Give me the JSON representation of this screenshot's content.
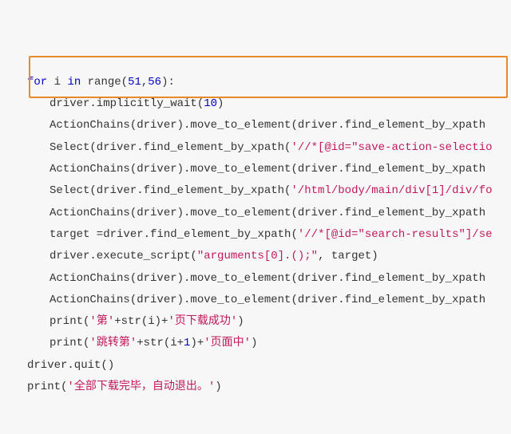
{
  "code": {
    "lines": [
      {
        "indent": 1,
        "segments": [
          {
            "t": "kw",
            "v": "for"
          },
          {
            "t": "p",
            "v": " i "
          },
          {
            "t": "kw",
            "v": "in"
          },
          {
            "t": "p",
            "v": " range("
          },
          {
            "t": "num",
            "v": "51"
          },
          {
            "t": "p",
            "v": ","
          },
          {
            "t": "num",
            "v": "56"
          },
          {
            "t": "p",
            "v": "):"
          }
        ]
      },
      {
        "indent": 2,
        "segments": [
          {
            "t": "p",
            "v": "driver.implicitly_wait("
          },
          {
            "t": "num",
            "v": "10"
          },
          {
            "t": "p",
            "v": ")"
          }
        ]
      },
      {
        "indent": 2,
        "segments": [
          {
            "t": "p",
            "v": "ActionChains(driver).move_to_element(driver.find_element_by_xpath"
          }
        ]
      },
      {
        "indent": 2,
        "segments": [
          {
            "t": "p",
            "v": ""
          }
        ]
      },
      {
        "indent": 2,
        "segments": [
          {
            "t": "p",
            "v": "Select(driver.find_element_by_xpath("
          },
          {
            "t": "str",
            "v": "'//*[@id=\"save-action-selectio"
          }
        ]
      },
      {
        "indent": 2,
        "segments": [
          {
            "t": "p",
            "v": "ActionChains(driver).move_to_element(driver.find_element_by_xpath"
          }
        ]
      },
      {
        "indent": 2,
        "segments": [
          {
            "t": "p",
            "v": "Select(driver.find_element_by_xpath("
          },
          {
            "t": "str",
            "v": "'/html/body/main/div[1]/div/fo"
          }
        ]
      },
      {
        "indent": 2,
        "segments": [
          {
            "t": "p",
            "v": "ActionChains(driver).move_to_element(driver.find_element_by_xpath"
          }
        ]
      },
      {
        "indent": 2,
        "segments": [
          {
            "t": "p",
            "v": ""
          }
        ]
      },
      {
        "indent": 2,
        "segments": [
          {
            "t": "p",
            "v": "target =driver.find_element_by_xpath("
          },
          {
            "t": "str",
            "v": "'//*[@id=\"search-results\"]/se"
          }
        ]
      },
      {
        "indent": 2,
        "segments": [
          {
            "t": "p",
            "v": ""
          }
        ]
      },
      {
        "indent": 2,
        "segments": [
          {
            "t": "p",
            "v": "driver.execute_script("
          },
          {
            "t": "str",
            "v": "\"arguments[0].();\""
          },
          {
            "t": "p",
            "v": ", target)"
          }
        ]
      },
      {
        "indent": 2,
        "segments": [
          {
            "t": "p",
            "v": "ActionChains(driver).move_to_element(driver.find_element_by_xpath"
          }
        ]
      },
      {
        "indent": 2,
        "segments": [
          {
            "t": "p",
            "v": "ActionChains(driver).move_to_element(driver.find_element_by_xpath"
          }
        ]
      },
      {
        "indent": 2,
        "segments": [
          {
            "t": "p",
            "v": "print("
          },
          {
            "t": "str",
            "v": "'第'"
          },
          {
            "t": "p",
            "v": "+str(i)+"
          },
          {
            "t": "str",
            "v": "'页下载成功'"
          },
          {
            "t": "p",
            "v": ")"
          }
        ]
      },
      {
        "indent": 2,
        "segments": [
          {
            "t": "p",
            "v": "print("
          },
          {
            "t": "str",
            "v": "'跳转第'"
          },
          {
            "t": "p",
            "v": "+str(i+"
          },
          {
            "t": "num",
            "v": "1"
          },
          {
            "t": "p",
            "v": ")+"
          },
          {
            "t": "str",
            "v": "'页面中'"
          },
          {
            "t": "p",
            "v": ")"
          }
        ]
      },
      {
        "indent": 1,
        "segments": [
          {
            "t": "p",
            "v": "driver.quit()"
          }
        ]
      },
      {
        "indent": 1,
        "segments": [
          {
            "t": "p",
            "v": "print("
          },
          {
            "t": "str",
            "v": "'全部下载完毕，自动退出。'"
          },
          {
            "t": "p",
            "v": ")"
          }
        ]
      }
    ]
  }
}
